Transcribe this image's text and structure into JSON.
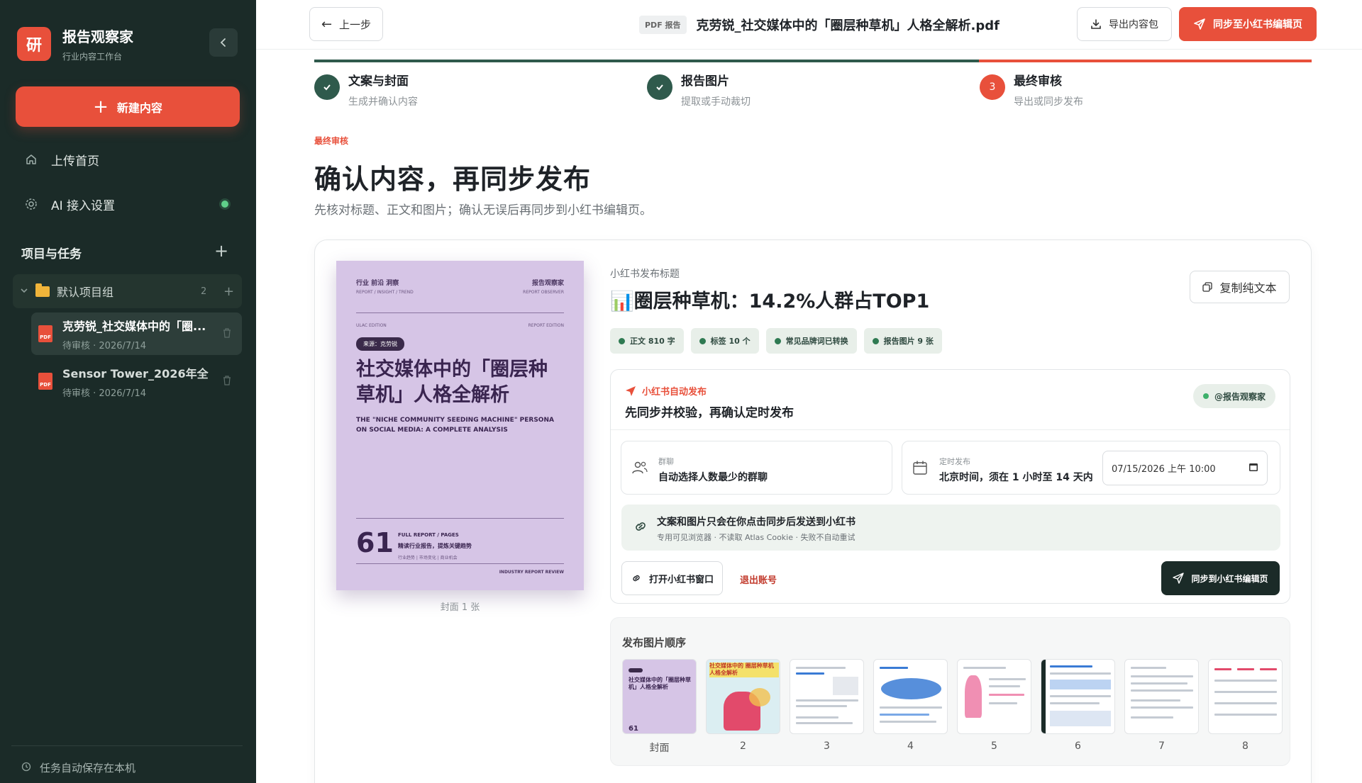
{
  "sidebar": {
    "brand_logo": "研",
    "brand_name": "报告观察家",
    "brand_sub": "行业内容工作台",
    "new_button": "新建内容",
    "nav": [
      {
        "label": "上传首页",
        "icon": "home-icon"
      },
      {
        "label": "AI 接入设置",
        "icon": "settings-icon",
        "status": "connected"
      }
    ],
    "section_title": "项目与任务",
    "group": {
      "name": "默认项目组",
      "count": "2"
    },
    "tasks": [
      {
        "title": "克劳锐_社交媒体中的「圈...",
        "meta": "待审核 · 2026/7/14",
        "active": true
      },
      {
        "title": "Sensor Tower_2026年全...",
        "meta": "待审核 · 2026/7/14",
        "active": false
      }
    ],
    "footer": "任务自动保存在本机"
  },
  "topbar": {
    "back_label": "上一步",
    "file_badge": "PDF 报告",
    "file_name": "克劳锐_社交媒体中的「圈层种草机」人格全解析.pdf",
    "export_label": "导出内容包",
    "sync_label": "同步至小红书编辑页"
  },
  "steps": [
    {
      "number": "✓",
      "title": "文案与封面",
      "subtitle": "生成并确认内容",
      "state": "done"
    },
    {
      "number": "✓",
      "title": "报告图片",
      "subtitle": "提取或手动裁切",
      "state": "done"
    },
    {
      "number": "3",
      "title": "最终审核",
      "subtitle": "导出或同步发布",
      "state": "current"
    }
  ],
  "heading": {
    "eyebrow": "最终审核",
    "title": "确认内容，再同步发布",
    "lead": "先核对标题、正文和图片；确认无误后再同步到小红书编辑页。"
  },
  "cover": {
    "tags_line": "行业  前沿  洞察",
    "tags_line_en": "REPORT / INSIGHT / TREND",
    "brand": "报告观察家",
    "brand_en": "REPORT OBSERVER",
    "edition_left": "ULAC EDITION",
    "edition_right": "REPORT EDITION",
    "source_pill": "来源：克劳锐",
    "title": "社交媒体中的「圈层种草机」人格全解析",
    "title_en": "THE \"NICHE COMMUNITY SEEDING MACHINE\" PERSONA ON SOCIAL MEDIA: A COMPLETE ANALYSIS",
    "pages": "61",
    "pages_label": "FULL REPORT / PAGES",
    "pages_desc": "精读行业报告，提炼关键趋势",
    "pages_tags": "行业趋势 | 市场变化 | 商业机会",
    "footer": "INDUSTRY REPORT REVIEW",
    "caption": "封面 1 张"
  },
  "publish": {
    "title_label": "小红书发布标题",
    "title": "📊圈层种草机：14.2%人群占TOP1",
    "copy_label": "复制纯文本",
    "tags": [
      "正文 810 字",
      "标签 10 个",
      "常见品牌词已转换",
      "报告图片 9 张"
    ]
  },
  "auto_publish": {
    "eyebrow": "小红书自动发布",
    "title": "先同步并校验，再确认定时发布",
    "account": "@报告观察家",
    "group_label": "群聊",
    "group_value": "自动选择人数最少的群聊",
    "schedule_label": "定时发布",
    "schedule_value": "北京时间，须在 1 小时至 14 天内",
    "datetime_value": "07/15/2026  上午 10:00",
    "notice_title": "文案和图片只会在你点击同步后发送到小红书",
    "notice_sub": "专用可见浏览器 · 不读取 Atlas Cookie · 失败不自动重试",
    "open_label": "打开小红书窗口",
    "logout_label": "退出账号",
    "sync_label": "同步到小红书编辑页"
  },
  "image_order": {
    "title": "发布图片顺序",
    "items": [
      "封面",
      "2",
      "3",
      "4",
      "5",
      "6",
      "7",
      "8"
    ],
    "thumb2_text": "社交媒体中的 圈层种草机 人格全解析"
  },
  "colors": {
    "accent": "#e8503b",
    "sidebar": "#1b2b28",
    "success": "#2f5a4c"
  }
}
